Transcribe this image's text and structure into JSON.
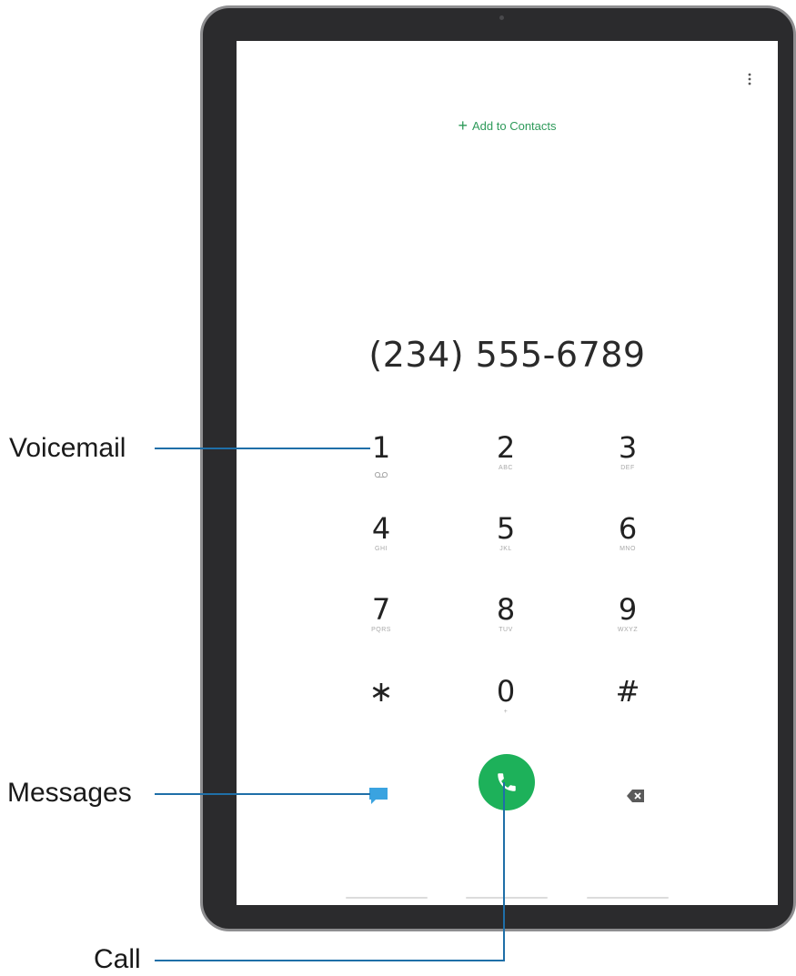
{
  "header": {
    "add_contacts_label": "Add to Contacts",
    "more_icon": "more-vertical-icon"
  },
  "dialer": {
    "number": "(234) 555-6789",
    "keys": [
      {
        "digit": "1",
        "sub": ""
      },
      {
        "digit": "2",
        "sub": "ABC"
      },
      {
        "digit": "3",
        "sub": "DEF"
      },
      {
        "digit": "4",
        "sub": "GHI"
      },
      {
        "digit": "5",
        "sub": "JKL"
      },
      {
        "digit": "6",
        "sub": "MNO"
      },
      {
        "digit": "7",
        "sub": "PQRS"
      },
      {
        "digit": "8",
        "sub": "TUV"
      },
      {
        "digit": "9",
        "sub": "WXYZ"
      },
      {
        "digit": "∗",
        "sub": ""
      },
      {
        "digit": "0",
        "sub": "+"
      },
      {
        "digit": "#",
        "sub": ""
      }
    ]
  },
  "actions": {
    "messages_icon": "message-icon",
    "call_icon": "phone-icon",
    "backspace_icon": "backspace-icon"
  },
  "callouts": {
    "voicemail": "Voicemail",
    "messages": "Messages",
    "call": "Call"
  },
  "colors": {
    "accent_green": "#1db15a",
    "link_green": "#2e9a5a",
    "message_blue": "#3aa3e0",
    "leader_blue": "#1f6fa8",
    "bezel": "#2b2b2d"
  }
}
